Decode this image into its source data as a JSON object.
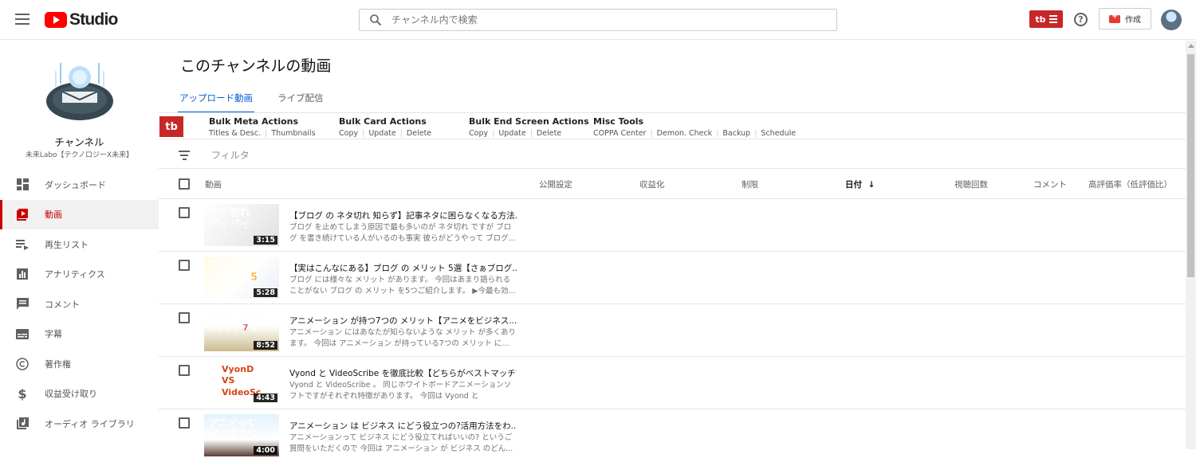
{
  "topbar": {
    "logo_text": "Studio",
    "search_placeholder": "チャンネル内で検索",
    "tb_logo": "tb",
    "create_label": "作成",
    "help_label": "?"
  },
  "sidebar": {
    "channel_name": "チャンネル",
    "channel_sub": "未来Labo【テクノロジーX未来】",
    "items": [
      {
        "label": "ダッシュボード",
        "icon": "dashboard-icon"
      },
      {
        "label": "動画",
        "icon": "videos-icon",
        "active": true
      },
      {
        "label": "再生リスト",
        "icon": "playlist-icon"
      },
      {
        "label": "アナリティクス",
        "icon": "analytics-icon"
      },
      {
        "label": "コメント",
        "icon": "comments-icon"
      },
      {
        "label": "字幕",
        "icon": "subtitles-icon"
      },
      {
        "label": "著作権",
        "icon": "copyright-icon"
      },
      {
        "label": "収益受け取り",
        "icon": "monetization-icon"
      },
      {
        "label": "オーディオ ライブラリ",
        "icon": "audio-library-icon"
      }
    ]
  },
  "main": {
    "title": "このチャンネルの動画",
    "tabs": [
      {
        "label": "アップロード動画",
        "active": true
      },
      {
        "label": "ライブ配信"
      }
    ],
    "tubebuddy": {
      "logo": "tb",
      "groups": [
        {
          "title": "Bulk Meta Actions",
          "links": [
            "Titles & Desc.",
            "Thumbnails"
          ]
        },
        {
          "title": "Bulk Card Actions",
          "links": [
            "Copy",
            "Update",
            "Delete"
          ]
        },
        {
          "title": "Bulk End Screen Actions",
          "links": [
            "Copy",
            "Update",
            "Delete"
          ]
        },
        {
          "title": "Misc Tools",
          "links": [
            "COPPA Center",
            "Demon. Check",
            "Backup",
            "Schedule"
          ]
        }
      ]
    },
    "filter_label": "フィルタ",
    "columns": {
      "video": "動画",
      "visibility": "公開設定",
      "monetization": "収益化",
      "restrictions": "制限",
      "date": "日付",
      "views": "視聴回数",
      "comments": "コメント",
      "likes": "高評価率（低評価比）"
    },
    "videos": [
      {
        "thumb_text": "ネタ切れ\nバイバイ",
        "duration": "3:15",
        "title": "【ブログ の ネタ切れ 知らず】記事ネタに困らなくなる方法...",
        "desc": "ブログ を止めてしまう原因で最も多いのが ネタ切れ ですが ブログ を書き続けている人がいるのも事実 彼らがどうやって ブログ..."
      },
      {
        "thumb_text": "ブログ\nメリット5",
        "duration": "5:28",
        "title": "【実はこんなにある】ブログ の メリット 5選【さぁブログ...",
        "desc": "ブログ には様々な メリット があります。 今回はあまり語られることがない ブログ の メリット を5つご紹介します。 ▶今最も効..."
      },
      {
        "thumb_text": "アニメーション\nメリット7つ",
        "duration": "8:52",
        "title": "アニメーション が持つ7つの メリット【アニメをビジネス...",
        "desc": "アニメーション にはあなたが知らないような メリット が多くあります。 今回は アニメーション が持っている7つの メリット に..."
      },
      {
        "thumb_text": "VyonD\nVS\nVideoSc",
        "duration": "4:43",
        "title": "Vyond と VideoScribe を徹底比較【どちらがベストマッチ?】",
        "desc": "Vyond と VideoScribe 。 同じホワイトボードアニメーションソフトですがそれぞれ特徴があります。 今回は Vyond と VideoScrib..."
      },
      {
        "thumb_text": "アニメって\nビジネスに",
        "duration": "4:00",
        "title": "アニメーション は ビジネス にどう役立つの?活用方法をわ...",
        "desc": "アニメーションって ビジネス にどう役立てればいいの? というご質問をいただくので 今回は アニメーション が ビジネス のどん..."
      }
    ]
  }
}
